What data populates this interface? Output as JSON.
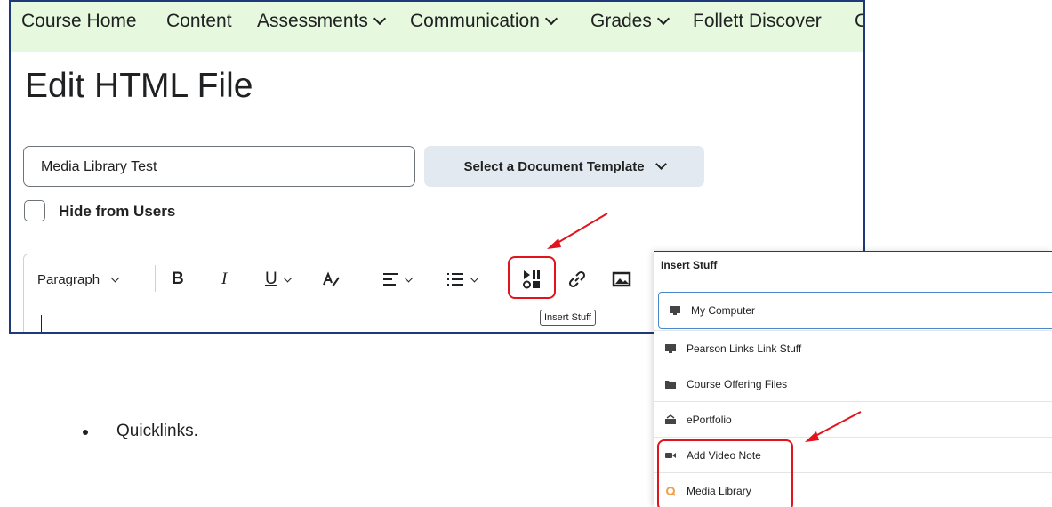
{
  "nav": {
    "items": [
      {
        "label": "Course Home",
        "has_dropdown": false
      },
      {
        "label": "Content",
        "has_dropdown": false
      },
      {
        "label": "Assessments",
        "has_dropdown": true
      },
      {
        "label": "Communication",
        "has_dropdown": true
      },
      {
        "label": "Grades",
        "has_dropdown": true
      },
      {
        "label": "Follett Discover",
        "has_dropdown": false
      },
      {
        "label": "C",
        "has_dropdown": false
      }
    ]
  },
  "page": {
    "title": "Edit HTML File",
    "title_input_value": "Media Library Test",
    "template_button_label": "Select a Document Template",
    "hide_checkbox_label": "Hide from Users",
    "hide_checkbox_checked": false
  },
  "toolbar": {
    "paragraph_label": "Paragraph",
    "bold_label": "B",
    "italic_label": "I",
    "underline_label": "U",
    "insert_stuff_tooltip": "Insert Stuff"
  },
  "bullet": {
    "text": "Quicklinks."
  },
  "dialog": {
    "title": "Insert Stuff",
    "items": [
      {
        "label": "My Computer",
        "icon": "computer-icon"
      },
      {
        "label": "Pearson Links Link Stuff",
        "icon": "computer-icon"
      },
      {
        "label": "Course Offering Files",
        "icon": "folder-icon"
      },
      {
        "label": "ePortfolio",
        "icon": "portfolio-icon"
      },
      {
        "label": "Add Video Note",
        "icon": "video-camera-icon"
      },
      {
        "label": "Media Library",
        "icon": "media-library-icon"
      }
    ]
  },
  "colors": {
    "nav_background": "#e6f9df",
    "highlight": "#e3131d",
    "arrow": "#e3131d",
    "template_button_bg": "#e3e9f1",
    "active_item_border": "#4a88c9",
    "media_library_icon": "#f0a04b"
  }
}
